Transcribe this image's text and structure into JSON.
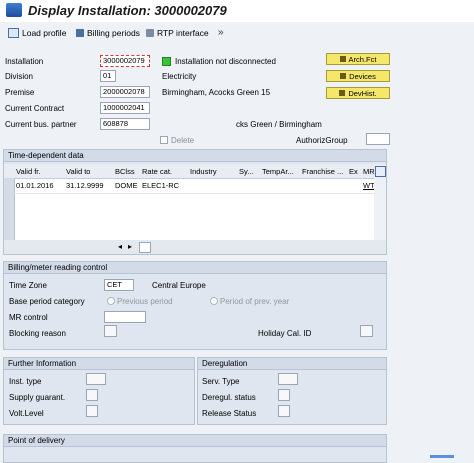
{
  "window": {
    "title": "Display Installation: 3000002079"
  },
  "toolbar": {
    "load_profile": "Load profile",
    "billing_periods": "Billing periods",
    "rtp_interface": "RTP interface"
  },
  "header_fields": {
    "installation_label": "Installation",
    "installation_value": "3000002079",
    "installation_status": "Installation not disconnected",
    "division_label": "Division",
    "division_value": "01",
    "division_text": "Electricity",
    "premise_label": "Premise",
    "premise_value": "2000002078",
    "premise_text": "Birmingham, Acocks Green  15",
    "contract_label": "Current Contract",
    "contract_value": "1000002041",
    "bus_partner_label": "Current bus. partner",
    "bus_partner_value": "608878",
    "bus_partner_text": "cks Green / Birmingham",
    "delete_label": "Delete",
    "authoriz_group_label": "AuthorizGroup"
  },
  "side_buttons": {
    "arch_fct": "Arch.Fct",
    "devices": "Devices",
    "devhist": "DevHist."
  },
  "time_dependent": {
    "title": "Time-dependent data",
    "columns": [
      "Valid fr.",
      "Valid to",
      "BClss",
      "Rate cat.",
      "Industry",
      "Sy...",
      "TempAr...",
      "Franchise ...",
      "Ex",
      "MR"
    ],
    "rows": [
      [
        "01.01.2016",
        "31.12.9999",
        "DOME",
        "ELEC1-RC",
        "",
        "",
        "",
        "",
        "",
        "WTM"
      ]
    ]
  },
  "billing_panel": {
    "title": "Billing/meter reading control",
    "time_zone_label": "Time Zone",
    "time_zone_value": "CET",
    "time_zone_text": "Central Europe",
    "base_period_label": "Base period category",
    "option_previous": "Previous period",
    "option_prev_year": "Period of prev. year",
    "mr_control_label": "MR control",
    "blocking_reason_label": "Blocking reason",
    "holiday_cal_label": "Holiday Cal. ID"
  },
  "further_info": {
    "title": "Further Information",
    "inst_type": "Inst. type",
    "supply_guarant": "Supply guarant.",
    "volt_level": "Volt.Level"
  },
  "deregulation": {
    "title": "Deregulation",
    "serv_type": "Serv. Type",
    "deregul_status": "Deregul. status",
    "release_status": "Release Status"
  },
  "point_of_delivery": {
    "title": "Point of delivery"
  },
  "colors": {
    "accent": "#1f4e9c",
    "status_green": "#3cc13c",
    "button_yellow": "#f5e76a"
  }
}
